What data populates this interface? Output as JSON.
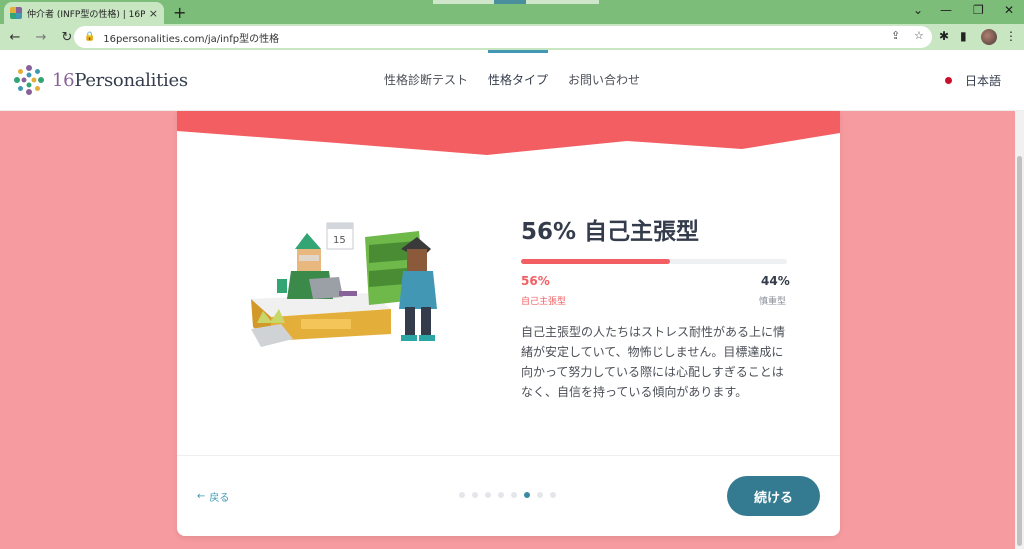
{
  "browser": {
    "tab_title": "仲介者 (INFP型の性格) | 16Perso",
    "tab_close": "×",
    "new_tab": "+",
    "url": "16personalities.com/ja/infp型の性格",
    "win_minimize": "—",
    "win_restore": "❐",
    "win_close": "✕",
    "dropdown": "⌄"
  },
  "header": {
    "logo_number": "16",
    "logo_word": "Personalities",
    "nav": [
      "性格診断テスト",
      "性格タイプ",
      "お問い合わせ"
    ],
    "active_nav_index": 1,
    "language": "日本語"
  },
  "card": {
    "title": "56% 自己主張型",
    "percent_left": "56%",
    "percent_right": "44%",
    "label_left": "自己主張型",
    "label_right": "慎重型",
    "fill_fraction": 0.56,
    "description": "自己主張型の人たちはストレス耐性がある上に情緒が安定していて、物怖じしません。目標達成に向かって努力している際には心配しすぎることはなく、自信を持っている傾向があります。",
    "calendar_day": "15",
    "back_label": "戻る",
    "next_label": "続ける",
    "pagination": {
      "total": 8,
      "current": 6
    }
  },
  "colors": {
    "page_bg": "#f69b9f",
    "accent_red": "#f25e62",
    "button_teal": "#347b91"
  }
}
